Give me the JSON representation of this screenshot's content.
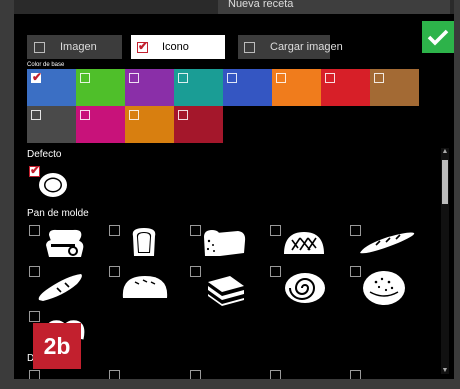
{
  "window": {
    "title": "Nueva receta"
  },
  "modes": [
    {
      "label": "Imagen",
      "checked": false
    },
    {
      "label": "Icono",
      "checked": true
    },
    {
      "label": "Cargar imagen",
      "checked": false
    }
  ],
  "colors": {
    "label": "Color de base",
    "swatches": [
      {
        "color": "#3b6fc4",
        "checked": true
      },
      {
        "color": "#4fbf2a",
        "checked": false
      },
      {
        "color": "#8a2fa8",
        "checked": false
      },
      {
        "color": "#1a9d95",
        "checked": false
      },
      {
        "color": "#3456c2",
        "checked": false
      },
      {
        "color": "#f07c1c",
        "checked": false
      },
      {
        "color": "#d71f28",
        "checked": false
      },
      {
        "color": "#a36a34",
        "checked": false
      },
      {
        "color": "#4a4a4a",
        "checked": false
      },
      {
        "color": "#c8127a",
        "checked": false
      },
      {
        "color": "#d87f10",
        "checked": false
      },
      {
        "color": "#a4172b",
        "checked": false
      }
    ]
  },
  "sections": {
    "default_label": "Defecto",
    "sandwich_label": "Pan de molde",
    "partial_label": "De"
  },
  "icons": {
    "default": [
      {
        "name": "plate-icon",
        "checked": true
      }
    ],
    "sandwich_row1": [
      "bread-stack-icon",
      "toast-slice-icon",
      "loaf-icon",
      "round-loaf-icon",
      "baguette-icon"
    ],
    "sandwich_row2": [
      "roll-icon",
      "bun-icon",
      "sliced-bread-icon",
      "spiral-roll-icon",
      "seeded-roll-icon"
    ]
  },
  "badge": {
    "text": "2b",
    "color": "#c2202e"
  },
  "accent": {
    "confirm": "#2db34a",
    "check": "#c2202e"
  }
}
